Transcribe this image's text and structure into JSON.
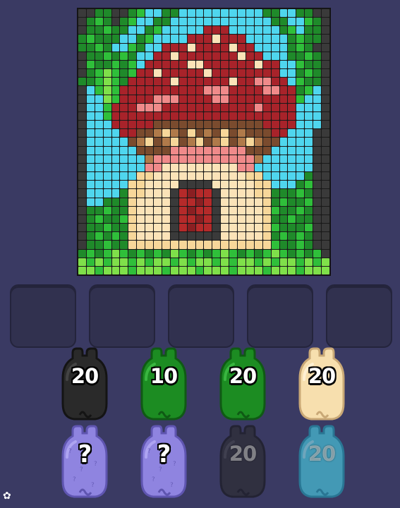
{
  "colors": {
    "background": "#3a3a63",
    "slot": "#31314f",
    "grid_line": "#1a1a1a",
    "palette": {
      "K": "#3a3a3a",
      "k": "#555555",
      "G": "#1f8a2a",
      "g": "#2fbf3a",
      "L": "#7fe04a",
      "B": "#4fd6ee",
      "R": "#a8232a",
      "r": "#d85a5a",
      "P": "#f08a8a",
      "W": "#fbe3b8",
      "C": "#f7d79a",
      "D": "#7a4b2e",
      "d": "#b07a4a",
      "M": "#b52a2a",
      "m": "#8a1f22"
    }
  },
  "pixel_art": {
    "subject": "mushroom-house",
    "rows": [
      "KKGGKKGgBBGGBBBBBBBBBBGGBBGGKK",
      "KGgGKGgBBGGBBBBBBBBBBBBGGBBgGK",
      "KGGgGGBBGgBBBBBRRRBBBBBBGgBGGK",
      "GgGGGBBGgBBBBRRRWRRRBBBBBGgGGK",
      "GGgGBBgGBBRRRWRRRRWRRBBBBGgGKK",
      "KGGgGgGBBRRWRRRRRRRWRRBBBGGgGK",
      "KgGGgGgBRRRRRWWRRRRRRWRRBBgGGK",
      "KGgLgGgRRWRRRRRWRRRRRRRRBBGgGK",
      "GGgLgGRRRRRWRRRRRRWRRPPRRBgGGK",
      "KBgLgRRRRRRRRRRPPPRRRRPPRRGgBK",
      "KBBLgRRRRPPPRRRRPPRRRRRRRRgBBK",
      "KBBgRRRPPPRRRRRRRRRRRPRRRRBBBK",
      "KBBgRRRRRRRRRRRRRRRRRRRRRRBBBK",
      "KBBBRRRRRDDDDDDDDDDDDDRRRRBBBK",
      "KBBBBRRDDdCdDCDdDCDdDDDRRBBBKK",
      "KBBBBBDdCDdCDdCDdCDdCdDDBBBBKK",
      "KBBBBBBDDDDPPPPPPPPPDDDBBBBBKK",
      "KBBBBBBBdPPPPPPPPPPPPdBBBBBBKK",
      "KBBBBBBBPPWWWWWWWWWPPBBBBBBBKK",
      "KBBBBBBCCWWWWWWWWWWWCCBBBBBGKK",
      "KBBBBBCCWWWWKKKKWWWWWCCBBBGgKK",
      "KBBBBGCCWWWKMmMMKWWWWCCGGGgGKK",
      "KBBGGGCWWWWKMMmMKWWWWWCGgGGgKK",
      "KGGgGGCWWWWKMmMMKWWWWWCgGGgGKK",
      "KGgGGgCWWWWKMMmMKWWWWWCGGgGGKK",
      "KGGgGGCWWWWKMmMMKWWWWWCgGGGgKK",
      "KGgGgGCWWWWKKKKKKWWWWWCGgGgGKK",
      "KGGgGGCCCCCCCCCCCCCCCCCgGGgGKK",
      "GgGgLgGgGgGLgGgGgLgGgGgLgGgGgK",
      "LgLgLLgLgLLgLgLLgLgLLgLgLLgLgL",
      "LLgLLLgLLLgLLLgLLLgLLLgLLLgLLL"
    ]
  },
  "slots": [
    {
      "name": "empty-slot-1"
    },
    {
      "name": "empty-slot-2"
    },
    {
      "name": "empty-slot-3"
    },
    {
      "name": "empty-slot-4"
    },
    {
      "name": "empty-slot-5"
    }
  ],
  "jars": [
    {
      "count": "20",
      "color": "#2a2a2a",
      "shade": "#141414",
      "hi": "#4a4a4a",
      "style": "solid"
    },
    {
      "count": "10",
      "color": "#1c8c22",
      "shade": "#0f5a14",
      "hi": "#41c049",
      "style": "solid"
    },
    {
      "count": "20",
      "color": "#1c8c22",
      "shade": "#0f5a14",
      "hi": "#41c049",
      "style": "solid"
    },
    {
      "count": "20",
      "color": "#f7dfae",
      "shade": "#c9a876",
      "hi": "#fff4dc",
      "style": "solid"
    },
    {
      "count": "?",
      "color": "#8f84e0",
      "shade": "#5f55b0",
      "hi": "#b5adf5",
      "style": "mystery"
    },
    {
      "count": "?",
      "color": "#8f84e0",
      "shade": "#5f55b0",
      "hi": "#b5adf5",
      "style": "mystery"
    },
    {
      "count": "20",
      "color": "#2a2a2a",
      "shade": "#141414",
      "hi": "#4a4a4a",
      "style": "faded"
    },
    {
      "count": "20",
      "color": "#49d8ec",
      "shade": "#1f9fb5",
      "hi": "#a5f1fb",
      "style": "faded"
    }
  ]
}
